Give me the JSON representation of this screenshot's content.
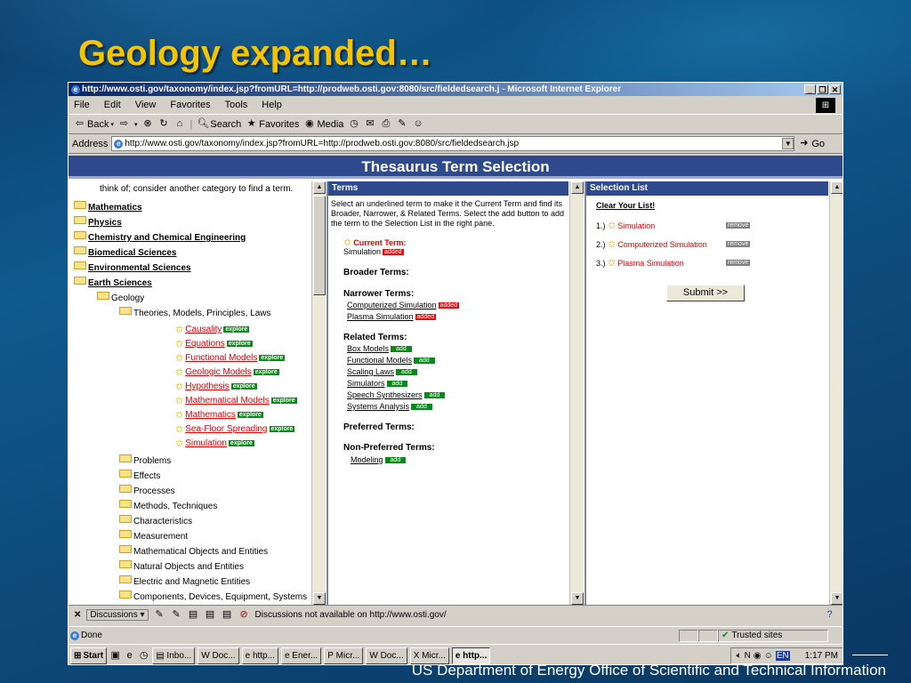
{
  "slide": {
    "title": "Geology expanded…",
    "footer": "US Department of Energy Office of Scientific and Technical Information"
  },
  "window": {
    "title": "http://www.osti.gov/taxonomy/index.jsp?fromURL=http://prodweb.osti.gov:8080/src/fieldedsearch.j - Microsoft Internet Explorer",
    "controls": [
      "_",
      "❐",
      "✕"
    ]
  },
  "menu": [
    "File",
    "Edit",
    "View",
    "Favorites",
    "Tools",
    "Help"
  ],
  "toolbar": {
    "back": "Back",
    "search": "Search",
    "favorites": "Favorites",
    "media": "Media"
  },
  "address": {
    "label": "Address",
    "url": "http://www.osti.gov/taxonomy/index.jsp?fromURL=http://prodweb.osti.gov:8080/src/fieldedsearch.jsp",
    "go": "Go"
  },
  "page": {
    "heading": "Thesaurus Term Selection"
  },
  "left_pane": {
    "intro": "think of; consider another category to find a term.",
    "top_categories": [
      "Mathematics",
      "Physics",
      "Chemistry and Chemical Engineering",
      "Biomedical Sciences",
      "Environmental Sciences",
      "Earth Sciences"
    ],
    "geology": "Geology",
    "theories": "Theories, Models, Principles, Laws",
    "theory_terms": [
      "Causality",
      "Equations",
      "Functional Models",
      "Geologic Models",
      "Hypothesis",
      "Mathematical Models",
      "Mathematics",
      "Sea-Floor Spreading",
      "Simulation"
    ],
    "explore_label": "explore",
    "subcategories": [
      "Problems",
      "Effects",
      "Processes",
      "Methods, Techniques",
      "Characteristics",
      "Measurement",
      "Mathematical Objects and Entities",
      "Natural Objects and Entities",
      "Electric and Magnetic Entities",
      "Components, Devices, Equipment, Systems"
    ]
  },
  "terms_pane": {
    "header": "Terms",
    "instructions": "Select an underlined term to make it the Current Term and find its Broader, Narrower, & Related Terms. Select the add button to add the term to the Selection List in the right pane.",
    "current_term_label": "Current Term:",
    "current_term": "Simulation",
    "added_label": "added",
    "add_label": "add",
    "broader_label": "Broader Terms:",
    "narrower_label": "Narrower Terms:",
    "narrower": [
      "Computerized Simulation",
      "Plasma Simulation"
    ],
    "related_label": "Related Terms:",
    "related": [
      "Box Models",
      "Functional Models",
      "Scaling Laws",
      "Simulators",
      "Speech Synthesizers",
      "Systems Analysis"
    ],
    "preferred_label": "Preferred Terms:",
    "nonpreferred_label": "Non-Preferred Terms:",
    "nonpreferred": [
      "Modeling"
    ]
  },
  "selection_pane": {
    "header": "Selection List",
    "clear": "Clear Your List!",
    "items": [
      {
        "num": "1.)",
        "term": "Simulation"
      },
      {
        "num": "2.)",
        "term": "Computerized Simulation"
      },
      {
        "num": "3.)",
        "term": "Plasma Simulation"
      }
    ],
    "remove_label": "remove",
    "submit": "Submit >>"
  },
  "discussion_bar": {
    "close": "✕",
    "label": "Discussions ▾",
    "message": "Discussions not available on http://www.osti.gov/"
  },
  "status_bar": {
    "status": "Done",
    "zone": "Trusted sites"
  },
  "taskbar": {
    "start": "Start",
    "buttons": [
      "Inbo...",
      "Doc...",
      "http...",
      "Ener...",
      "Micr...",
      "Doc...",
      "Micr...",
      "http..."
    ],
    "lang": "EN",
    "clock": "1:17 PM"
  }
}
